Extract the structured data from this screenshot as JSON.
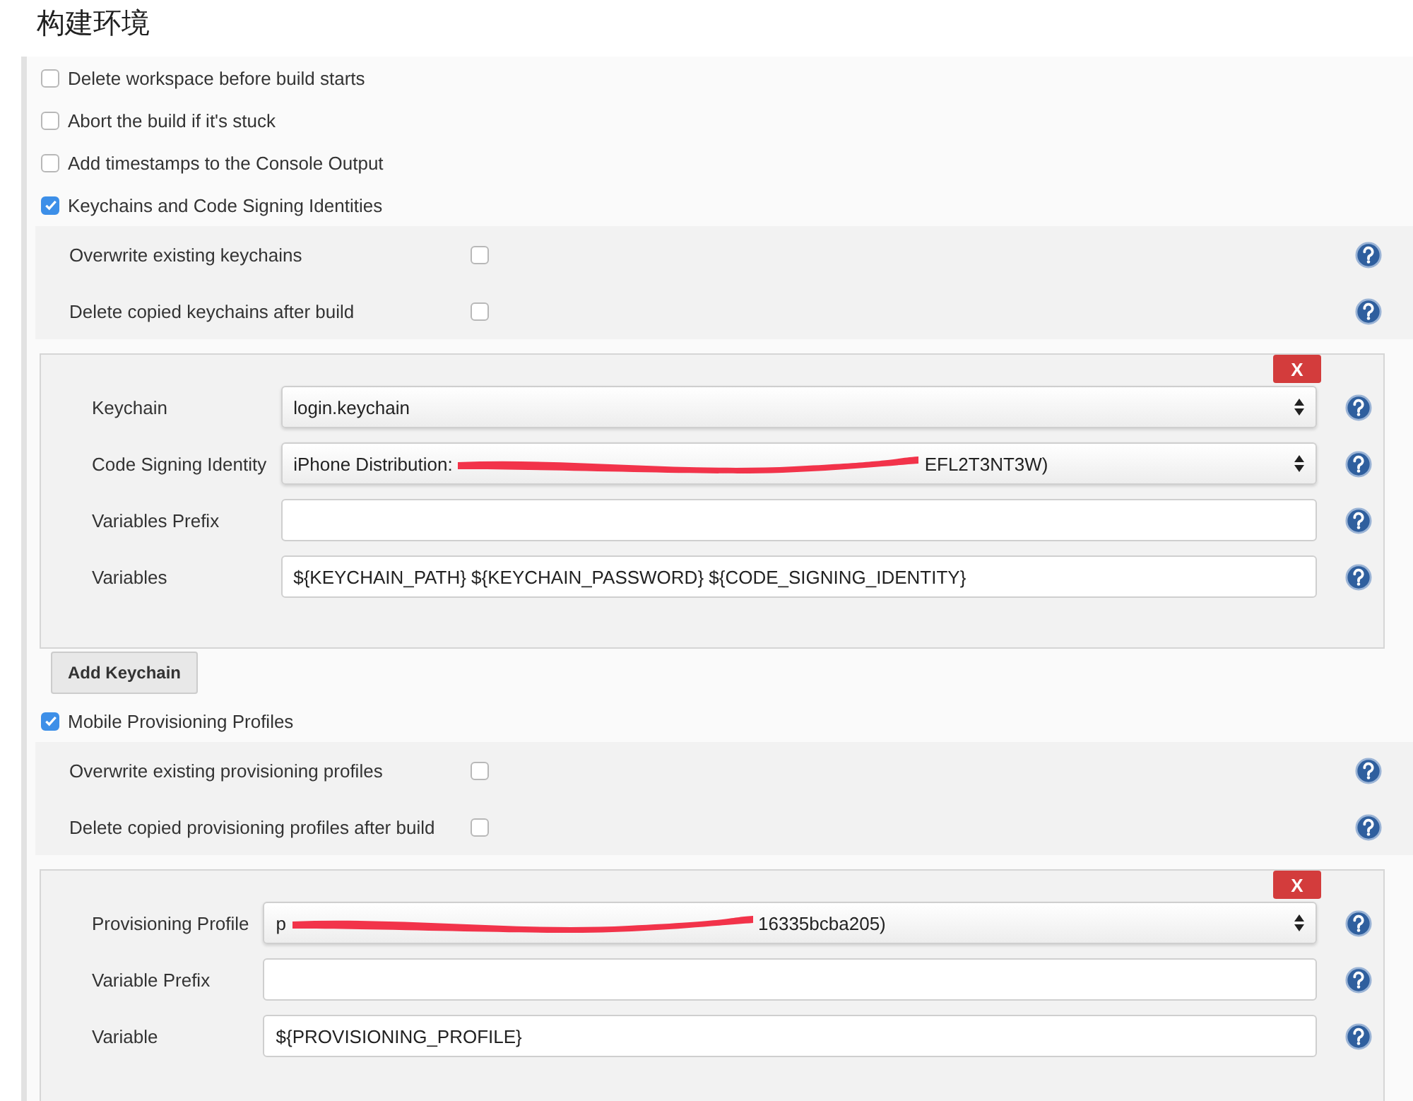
{
  "title": "构建环境",
  "options": [
    {
      "label": "Delete workspace before build starts",
      "checked": false
    },
    {
      "label": "Abort the build if it's stuck",
      "checked": false
    },
    {
      "label": "Add timestamps to the Console Output",
      "checked": false
    },
    {
      "label": "Keychains and Code Signing Identities",
      "checked": true,
      "settings": [
        {
          "label": "Overwrite existing keychains",
          "checked": false
        },
        {
          "label": "Delete copied keychains after build",
          "checked": false
        }
      ],
      "entry": {
        "delete_button": "X",
        "fields": [
          {
            "label": "Keychain",
            "kind": "select",
            "value": "login.keychain"
          },
          {
            "label": "Code Signing Identity",
            "kind": "redacted-select",
            "value_start": "iPhone Distribution:",
            "value_end": "EFL2T3NT3W)"
          },
          {
            "label": "Variables Prefix",
            "kind": "text"
          },
          {
            "label": "Variables",
            "kind": "text",
            "value": "${KEYCHAIN_PATH} ${KEYCHAIN_PASSWORD} ${CODE_SIGNING_IDENTITY}"
          }
        ]
      },
      "add_button": "Add Keychain"
    },
    {
      "label": "Mobile Provisioning Profiles",
      "checked": true,
      "settings": [
        {
          "label": "Overwrite existing provisioning profiles",
          "checked": false
        },
        {
          "label": "Delete copied provisioning profiles after build",
          "checked": false
        }
      ],
      "entry": {
        "delete_button": "X",
        "fields": [
          {
            "label": "Provisioning Profile",
            "kind": "redacted-select",
            "value_start": "p",
            "value_end": "16335bcba205)"
          },
          {
            "label": "Variable Prefix",
            "kind": "text"
          },
          {
            "label": "Variable",
            "kind": "text",
            "value": "${PROVISIONING_PROFILE}"
          }
        ]
      }
    }
  ]
}
